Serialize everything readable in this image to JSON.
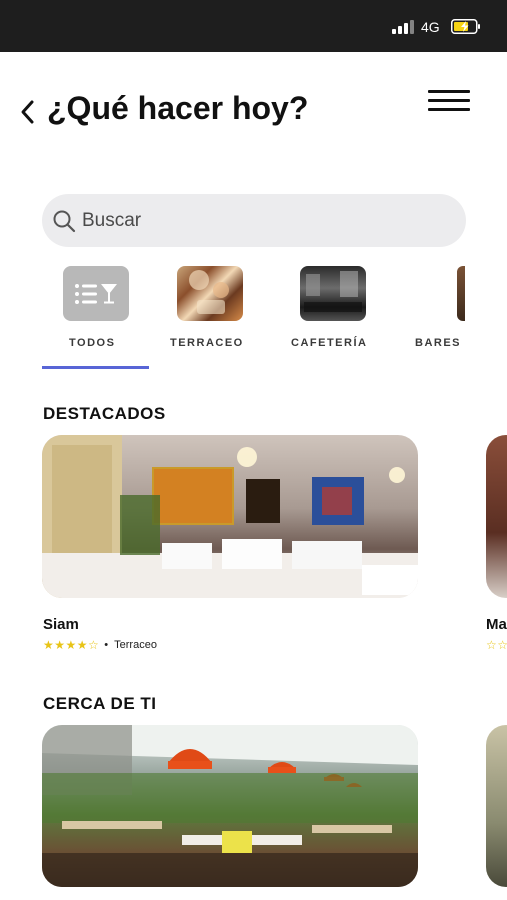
{
  "status_bar": {
    "network": "4G"
  },
  "header": {
    "title": "¿Qué hacer hoy?"
  },
  "search": {
    "placeholder": "Buscar"
  },
  "categories": [
    {
      "label": "TODOS",
      "active": true
    },
    {
      "label": "TERRACEO"
    },
    {
      "label": "CAFETERÍA"
    },
    {
      "label": "BARES"
    }
  ],
  "sections": {
    "featured": {
      "title": "DESTACADOS",
      "cards": [
        {
          "name": "Siam",
          "rating": 4,
          "max_rating": 5,
          "category": "Terraceo"
        },
        {
          "name": "Ma",
          "rating": 0,
          "max_rating": 5
        }
      ]
    },
    "nearby": {
      "title": "CERCA DE TI"
    }
  },
  "colors": {
    "accent": "#5865d6",
    "star": "#e8c417",
    "search_bg": "#ececee",
    "status_bar": "#1e1e1e"
  }
}
